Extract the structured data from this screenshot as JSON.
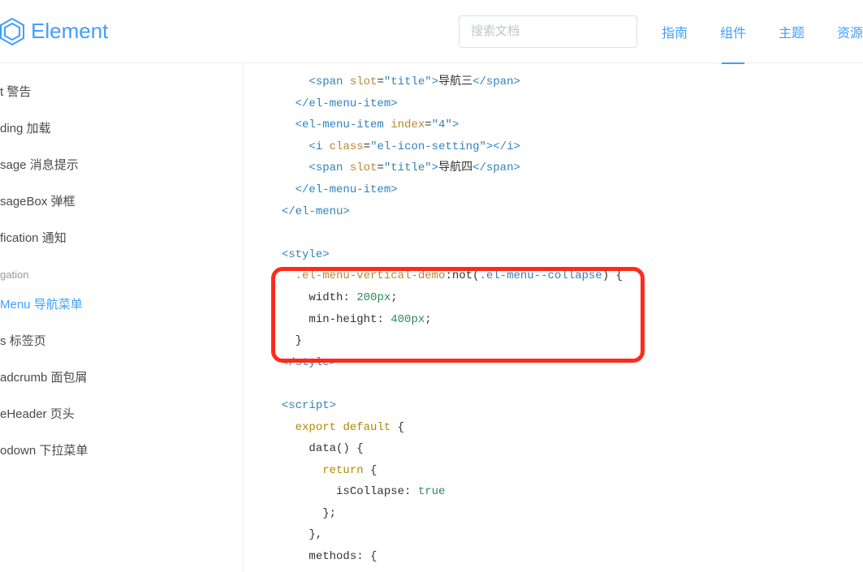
{
  "header": {
    "brand": "Element",
    "search_placeholder": "搜索文档",
    "nav": [
      "指南",
      "组件",
      "主题",
      "资源"
    ],
    "active_nav_index": 1
  },
  "sidebar": {
    "items_top": [
      "t 警告",
      "ding 加载",
      "sage 消息提示",
      "sageBox 弹框",
      "fication 通知"
    ],
    "group_label": "gation",
    "items_group": [
      "Menu 导航菜单",
      "s 标签页",
      "adcrumb 面包屑",
      "eHeader 页头",
      "odown 下拉菜单"
    ],
    "active_item": "Menu 导航菜单"
  },
  "code": {
    "lines": [
      {
        "indent": 6,
        "tokens": [
          [
            "tag",
            "<span"
          ],
          [
            "txt",
            " "
          ],
          [
            "attrname",
            "slot"
          ],
          [
            "txt",
            "="
          ],
          [
            "attrval",
            "\"title\""
          ],
          [
            "tag",
            ">"
          ],
          [
            "txt",
            "导航三"
          ],
          [
            "tag",
            "</span>"
          ]
        ]
      },
      {
        "indent": 4,
        "tokens": [
          [
            "tag",
            "</el-menu-item>"
          ]
        ]
      },
      {
        "indent": 4,
        "tokens": [
          [
            "tag",
            "<el-menu-item"
          ],
          [
            "txt",
            " "
          ],
          [
            "attrname",
            "index"
          ],
          [
            "txt",
            "="
          ],
          [
            "attrval",
            "\"4\""
          ],
          [
            "tag",
            ">"
          ]
        ]
      },
      {
        "indent": 6,
        "tokens": [
          [
            "tag",
            "<i"
          ],
          [
            "txt",
            " "
          ],
          [
            "attrname",
            "class"
          ],
          [
            "txt",
            "="
          ],
          [
            "attrval",
            "\"el-icon-setting\""
          ],
          [
            "tag",
            "></i>"
          ]
        ]
      },
      {
        "indent": 6,
        "tokens": [
          [
            "tag",
            "<span"
          ],
          [
            "txt",
            " "
          ],
          [
            "attrname",
            "slot"
          ],
          [
            "txt",
            "="
          ],
          [
            "attrval",
            "\"title\""
          ],
          [
            "tag",
            ">"
          ],
          [
            "txt",
            "导航四"
          ],
          [
            "tag",
            "</span>"
          ]
        ]
      },
      {
        "indent": 4,
        "tokens": [
          [
            "tag",
            "</el-menu-item>"
          ]
        ]
      },
      {
        "indent": 2,
        "tokens": [
          [
            "tag",
            "</el-menu>"
          ]
        ]
      },
      {
        "indent": 0,
        "tokens": [
          [
            "txt",
            ""
          ]
        ]
      },
      {
        "indent": 2,
        "tokens": [
          [
            "tag",
            "<style>"
          ]
        ]
      },
      {
        "indent": 4,
        "tokens": [
          [
            "sel",
            ".el-menu-vertical-demo"
          ],
          [
            "pseudo",
            ":not("
          ],
          [
            "arg",
            ".el-menu--collapse"
          ],
          [
            "pseudo",
            ")"
          ],
          [
            "txt",
            " {"
          ]
        ]
      },
      {
        "indent": 6,
        "tokens": [
          [
            "prop",
            "width"
          ],
          [
            "txt",
            ": "
          ],
          [
            "num",
            "200px"
          ],
          [
            "txt",
            ";"
          ]
        ]
      },
      {
        "indent": 6,
        "tokens": [
          [
            "prop",
            "min-height"
          ],
          [
            "txt",
            ": "
          ],
          [
            "num",
            "400px"
          ],
          [
            "txt",
            ";"
          ]
        ]
      },
      {
        "indent": 4,
        "tokens": [
          [
            "txt",
            "}"
          ]
        ]
      },
      {
        "indent": 2,
        "tokens": [
          [
            "tag",
            "</style>"
          ]
        ]
      },
      {
        "indent": 0,
        "tokens": [
          [
            "txt",
            ""
          ]
        ]
      },
      {
        "indent": 2,
        "tokens": [
          [
            "tag",
            "<script>"
          ]
        ]
      },
      {
        "indent": 4,
        "tokens": [
          [
            "kw",
            "export"
          ],
          [
            "txt",
            " "
          ],
          [
            "kw",
            "default"
          ],
          [
            "txt",
            " {"
          ]
        ]
      },
      {
        "indent": 6,
        "tokens": [
          [
            "txt",
            "data() {"
          ]
        ]
      },
      {
        "indent": 8,
        "tokens": [
          [
            "kw",
            "return"
          ],
          [
            "txt",
            " {"
          ]
        ]
      },
      {
        "indent": 10,
        "tokens": [
          [
            "prop",
            "isCollapse"
          ],
          [
            "txt",
            ": "
          ],
          [
            "lit",
            "true"
          ]
        ]
      },
      {
        "indent": 8,
        "tokens": [
          [
            "txt",
            "};"
          ]
        ]
      },
      {
        "indent": 6,
        "tokens": [
          [
            "txt",
            "},"
          ]
        ]
      },
      {
        "indent": 6,
        "tokens": [
          [
            "prop",
            "methods"
          ],
          [
            "txt",
            ": {"
          ]
        ]
      }
    ]
  }
}
